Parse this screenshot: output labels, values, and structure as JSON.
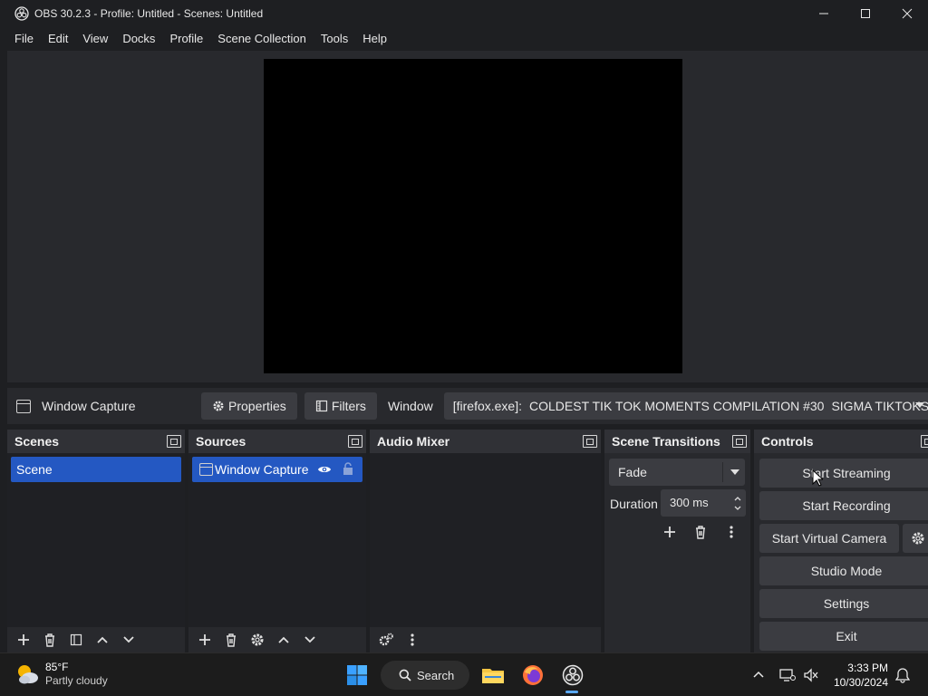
{
  "window": {
    "title": "OBS 30.2.3 - Profile: Untitled - Scenes: Untitled"
  },
  "menu": [
    "File",
    "Edit",
    "View",
    "Docks",
    "Profile",
    "Scene Collection",
    "Tools",
    "Help"
  ],
  "source_bar": {
    "selected_source": "Window Capture",
    "properties_label": "Properties",
    "filters_label": "Filters",
    "window_label": "Window",
    "window_value_prefix": "[firefox.exe]:",
    "window_value_title": "COLDEST TIK TOK MOMENTS COMPILATION #30",
    "window_value_suffix": "SIGMA TIKTOKS"
  },
  "docks": {
    "scenes": {
      "title": "Scenes",
      "items": [
        "Scene"
      ]
    },
    "sources": {
      "title": "Sources",
      "items": [
        "Window Capture"
      ]
    },
    "audio_mixer": {
      "title": "Audio Mixer"
    },
    "transitions": {
      "title": "Scene Transitions",
      "selected": "Fade",
      "duration_label": "Duration",
      "duration_value": "300 ms"
    },
    "controls": {
      "title": "Controls",
      "start_streaming": "Start Streaming",
      "start_recording": "Start Recording",
      "start_virtual_camera": "Start Virtual Camera",
      "studio_mode": "Studio Mode",
      "settings": "Settings",
      "exit": "Exit"
    }
  },
  "taskbar": {
    "weather_temp": "85°F",
    "weather_desc": "Partly cloudy",
    "search_label": "Search",
    "time": "3:33 PM",
    "date": "10/30/2024"
  },
  "colors": {
    "accent": "#2458c2",
    "panel": "#28292d",
    "button": "#3b3c41"
  }
}
